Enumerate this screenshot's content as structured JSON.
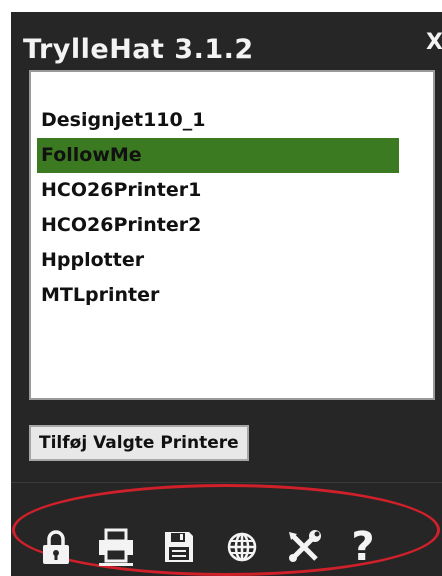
{
  "window": {
    "title": "TrylleHat 3.1.2",
    "close_label": "X"
  },
  "printers": {
    "items": [
      {
        "label": "Designjet110_1",
        "selected": false
      },
      {
        "label": "FollowMe",
        "selected": true
      },
      {
        "label": "HCO26Printer1",
        "selected": false
      },
      {
        "label": "HCO26Printer2",
        "selected": false
      },
      {
        "label": "Hpplotter",
        "selected": false
      },
      {
        "label": "MTLprinter",
        "selected": false
      }
    ]
  },
  "actions": {
    "add_label": "Tilføj Valgte Printere"
  },
  "toolbar": {
    "icons": [
      "lock-icon",
      "printer-icon",
      "save-icon",
      "globe-icon",
      "tools-icon",
      "help-icon"
    ],
    "help_label": "?"
  },
  "colors": {
    "background": "#262626",
    "selection": "#3c7a22",
    "highlight_ring": "#d0202a",
    "text_light": "#f3f3f3"
  }
}
